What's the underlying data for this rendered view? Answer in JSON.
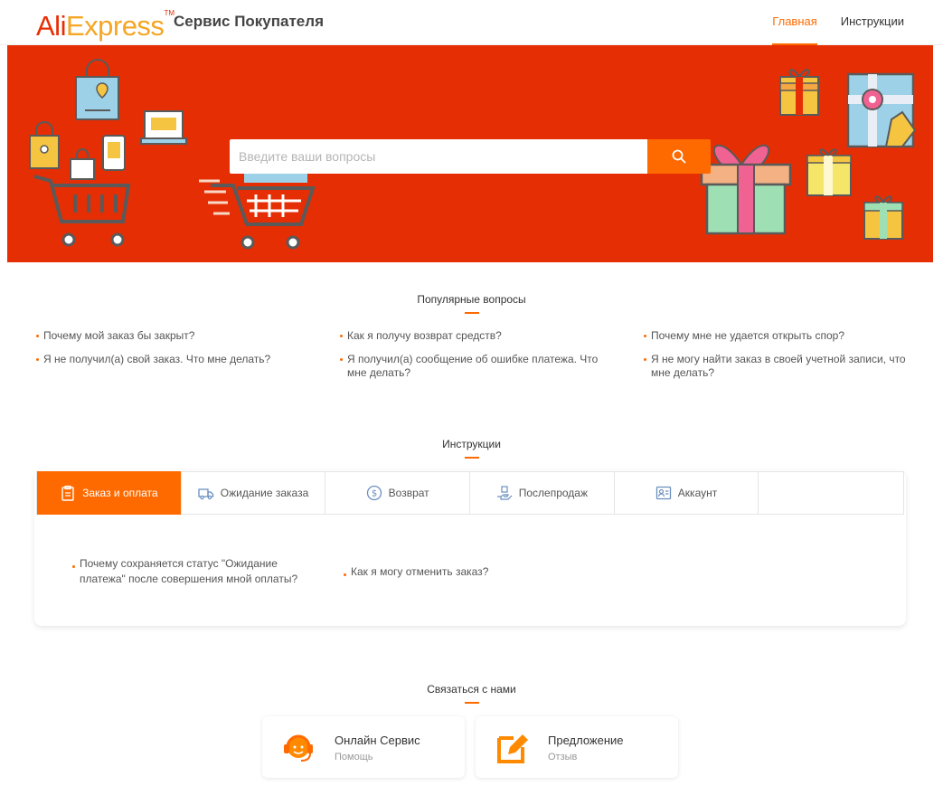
{
  "header": {
    "logo_part1": "Ali",
    "logo_part2": "Express",
    "logo_tm": "TM",
    "service_title": "Сервис Покупателя",
    "nav": [
      {
        "label": "Главная",
        "active": true
      },
      {
        "label": "Инструкции",
        "active": false
      }
    ]
  },
  "search": {
    "placeholder": "Введите ваши вопросы"
  },
  "popular": {
    "title": "Популярные вопросы",
    "columns": [
      [
        "Почему мой заказ бы закрыт?",
        "Я не получил(а) свой заказ. Что мне делать?"
      ],
      [
        "Как я получу возврат средств?",
        "Я получил(а) сообщение об ошибке платежа. Что мне делать?"
      ],
      [
        "Почему мне не удается открыть спор?",
        "Я не могу найти заказ в своей учетной записи, что мне делать?"
      ]
    ]
  },
  "instructions": {
    "title": "Инструкции",
    "tabs": [
      {
        "label": "Заказ и оплата",
        "icon": "clipboard-icon",
        "active": true
      },
      {
        "label": "Ожидание заказа",
        "icon": "truck-icon",
        "active": false
      },
      {
        "label": "Возврат",
        "icon": "dollar-icon",
        "active": false
      },
      {
        "label": "Послепродаж",
        "icon": "hand-box-icon",
        "active": false
      },
      {
        "label": "Аккаунт",
        "icon": "account-icon",
        "active": false
      },
      {
        "label": "",
        "icon": "",
        "active": false
      }
    ],
    "items": [
      "Почему сохраняется статус \"Ожидание платежа\" после совершения мной оплаты?",
      "Как я могу отменить заказ?"
    ]
  },
  "contact": {
    "title": "Связаться с нами",
    "cards": [
      {
        "title": "Онлайн Сервис",
        "subtitle": "Помощь",
        "icon": "headset-icon"
      },
      {
        "title": "Предложение",
        "subtitle": "Отзыв",
        "icon": "edit-icon"
      }
    ]
  },
  "colors": {
    "brand_red": "#e62e04",
    "accent_orange": "#ff6a00",
    "logo_yellow": "#f5a623"
  }
}
